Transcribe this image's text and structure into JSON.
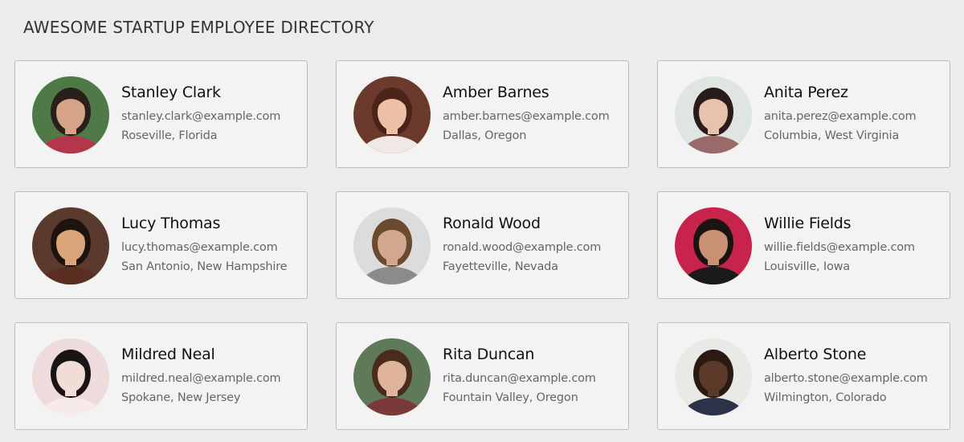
{
  "page": {
    "title": "AWESOME STARTUP EMPLOYEE DIRECTORY"
  },
  "employees": [
    {
      "name": "Stanley Clark",
      "email": "stanley.clark@example.com",
      "location": "Roseville, Florida",
      "avatar": {
        "bg": "#4f7a48",
        "skin": "#d6a488",
        "hair": "#2a1f1a",
        "shirt": "#b4364a"
      }
    },
    {
      "name": "Amber Barnes",
      "email": "amber.barnes@example.com",
      "location": "Dallas, Oregon",
      "avatar": {
        "bg": "#6b3a2c",
        "skin": "#eebfa7",
        "hair": "#4a2418",
        "shirt": "#f0e8e4"
      }
    },
    {
      "name": "Anita Perez",
      "email": "anita.perez@example.com",
      "location": "Columbia, West Virginia",
      "avatar": {
        "bg": "#dfe6e2",
        "skin": "#e9c2ac",
        "hair": "#2a1c1a",
        "shirt": "#9a6a6a"
      }
    },
    {
      "name": "Lucy Thomas",
      "email": "lucy.thomas@example.com",
      "location": "San Antonio, New Hampshire",
      "avatar": {
        "bg": "#5a3a2c",
        "skin": "#d9a579",
        "hair": "#1e140f",
        "shirt": "#5a2f22"
      }
    },
    {
      "name": "Ronald Wood",
      "email": "ronald.wood@example.com",
      "location": "Fayetteville, Nevada",
      "avatar": {
        "bg": "#dcdcdc",
        "skin": "#d1a88f",
        "hair": "#6b4a2e",
        "shirt": "#8b8b8b"
      }
    },
    {
      "name": "Willie Fields",
      "email": "willie.fields@example.com",
      "location": "Louisville, Iowa",
      "avatar": {
        "bg": "#c8234a",
        "skin": "#c99074",
        "hair": "#1c1412",
        "shirt": "#1a1a1a"
      }
    },
    {
      "name": "Mildred Neal",
      "email": "mildred.neal@example.com",
      "location": "Spokane, New Jersey",
      "avatar": {
        "bg": "#eedcdc",
        "skin": "#f1dcd6",
        "hair": "#1b1415",
        "shirt": "#f6eaea"
      }
    },
    {
      "name": "Rita Duncan",
      "email": "rita.duncan@example.com",
      "location": "Fountain Valley, Oregon",
      "avatar": {
        "bg": "#5e7a58",
        "skin": "#e0b49a",
        "hair": "#4a2c1c",
        "shirt": "#7a3a3a"
      }
    },
    {
      "name": "Alberto Stone",
      "email": "alberto.stone@example.com",
      "location": "Wilmington, Colorado",
      "avatar": {
        "bg": "#e9e9e6",
        "skin": "#5b3a2a",
        "hair": "#2a1a12",
        "shirt": "#2a3348"
      }
    }
  ]
}
